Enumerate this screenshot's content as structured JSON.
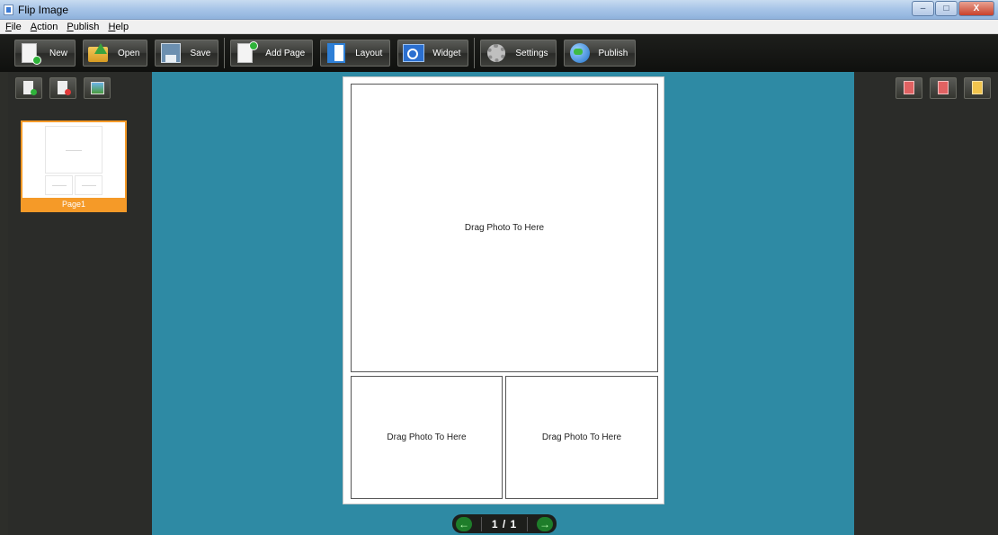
{
  "window": {
    "title": "Flip Image",
    "controls": [
      "–",
      "□",
      "X"
    ]
  },
  "menu": [
    {
      "hot": "F",
      "rest": "ile"
    },
    {
      "hot": "A",
      "rest": "ction"
    },
    {
      "hot": "P",
      "rest": "ublish"
    },
    {
      "hot": "H",
      "rest": "elp"
    }
  ],
  "toolbar": {
    "new": "New",
    "open": "Open",
    "save": "Save",
    "add_page": "Add Page",
    "layout": "Layout",
    "widget": "Widget",
    "settings": "Settings",
    "publish": "Publish"
  },
  "left_panel": {
    "pages": [
      {
        "label": "Page1",
        "selected": true
      }
    ]
  },
  "workspace": {
    "slot_text": "Drag Photo To Here",
    "slot_text_2": "Drag Photo To Here",
    "slot_text_3": "Drag Photo To Here"
  },
  "pager": {
    "prev": "←",
    "text": "1 / 1",
    "next": "→"
  },
  "colors": {
    "accent": "#f59a28",
    "workspace_bg": "#2e8aa4",
    "panel_bg": "#2b2c29"
  }
}
